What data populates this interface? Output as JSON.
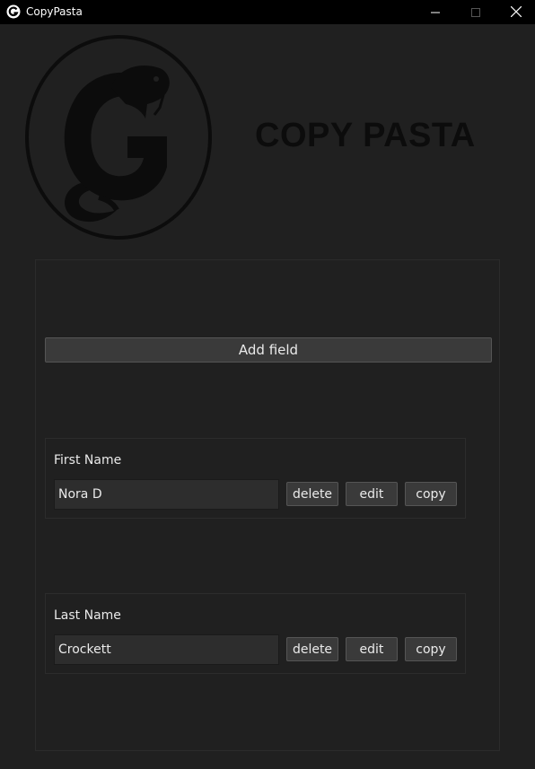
{
  "window": {
    "title": "CopyPasta",
    "icons": [
      "app-logo-icon",
      "minimize-icon",
      "maximize-icon",
      "close-icon"
    ]
  },
  "header": {
    "brand_title": "COPY PASTA",
    "logo": "snake-g-logo"
  },
  "toolbar": {
    "add_field_label": "Add field"
  },
  "fields": [
    {
      "label": "First Name",
      "value": "Nora D",
      "delete_label": "delete",
      "edit_label": "edit",
      "copy_label": "copy"
    },
    {
      "label": "Last Name",
      "value": "Crockett",
      "delete_label": "delete",
      "edit_label": "edit",
      "copy_label": "copy"
    }
  ],
  "colors": {
    "background": "#202020",
    "titlebar": "#000000",
    "button": "#3a3a3a",
    "input": "#2d2d2d",
    "logo": "#0c0c0c"
  }
}
